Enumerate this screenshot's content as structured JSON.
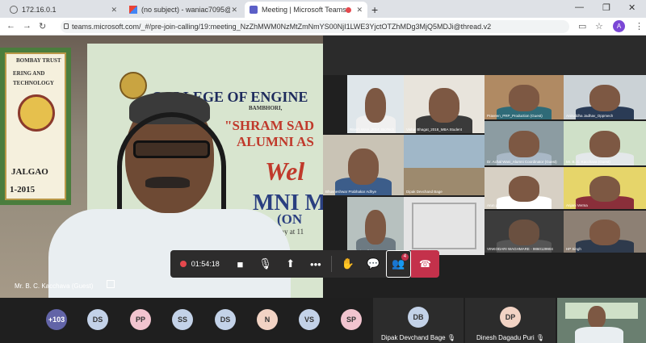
{
  "browser": {
    "tabs": [
      {
        "title": "172.16.0.1",
        "favicon": "globe-icon",
        "active": false
      },
      {
        "title": "(no subject) - waniac7095@gmai",
        "favicon": "gmail-icon",
        "active": false
      },
      {
        "title": "Meeting | Microsoft Teams",
        "favicon": "teams-icon",
        "active": true
      }
    ],
    "url": "teams.microsoft.com/_#/pre-join-calling/19:meeting_NzZhMWM0NzMtZmNmYS00NjI1LWE3YjctOTZhMDg3MjQ5MDJi@thread.v2",
    "profile_initial": "A"
  },
  "speaker": {
    "name": "Mr. B. C. Kacchava (Guest)",
    "banner_lines": [
      "COLLEGE OF ENGINE",
      "\"SHRAM SAD",
      "ALUMNI AS",
      "Wel",
      "MNI M",
      "(ON",
      "urday at 11",
      "BAMBHORI,"
    ],
    "left_banner_lines": [
      "BOMBAY TRUST",
      "ERING AND",
      "TECHNOLOGY",
      "JALGAO",
      "1-2015"
    ]
  },
  "gallery": {
    "tiles": [
      {
        "label": "Ritesh Wani_2014_BioTech"
      },
      {
        "label": "Vishal Bhagat_2018_MBA Student"
      },
      {
        "label": "Praveen_PRP_Production (Guest)"
      },
      {
        "label": "Aniruddha Jadhav_Oppmech"
      },
      {
        "label": "Pankaj Padhbhane"
      },
      {
        "label": "Dr. Achal Wani_Alumni Coordinator (Guest)"
      },
      {
        "label": "Mr. B. C. Kacchava (Guest)"
      },
      {
        "label": "Bhuvneshwar Prabhakar Adhye"
      },
      {
        "label": "Dipak Devchand Bage"
      },
      {
        "label": "Arun pandey"
      },
      {
        "label": "Anjani Verma"
      },
      {
        "label": "Venkatesh Kulkarni"
      },
      {
        "label": "VINKODARI WAGHMARE - 9860129904"
      },
      {
        "label": "HP Singh"
      }
    ]
  },
  "controls": {
    "timer": "01:54:18",
    "participants_badge": "4"
  },
  "participants": {
    "overflow": "+103",
    "chips": [
      {
        "initials": "DS",
        "color": "#c3d2e8"
      },
      {
        "initials": "PP",
        "color": "#f2c4cf"
      },
      {
        "initials": "SS",
        "color": "#c3d2e8"
      },
      {
        "initials": "DS",
        "color": "#c3d2e8"
      },
      {
        "initials": "N",
        "color": "#f2d3c4"
      },
      {
        "initials": "VS",
        "color": "#c3d2e8"
      },
      {
        "initials": "SP",
        "color": "#f2c4cf"
      }
    ],
    "named": [
      {
        "initials": "DB",
        "name": "Dipak Devchand Bage",
        "color": "#c3d2e8"
      },
      {
        "initials": "DP",
        "name": "Dinesh Dagadu Puri",
        "color": "#f2d3c4"
      }
    ]
  },
  "colors": {
    "leave_red": "#c4314b",
    "overflow_purple": "#6264a7"
  }
}
